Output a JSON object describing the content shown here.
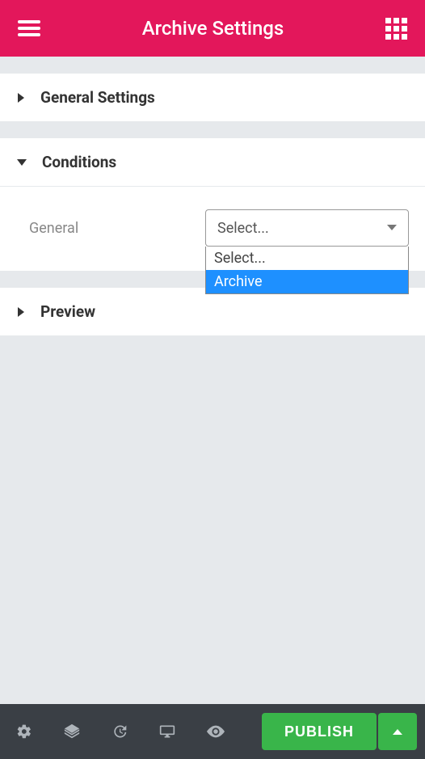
{
  "header": {
    "title": "Archive Settings"
  },
  "sections": {
    "general_settings": {
      "title": "General Settings",
      "expanded": false
    },
    "conditions": {
      "title": "Conditions",
      "expanded": true,
      "field_label": "General",
      "select_value": "Select...",
      "options": {
        "opt0": "Select...",
        "opt1": "Archive"
      }
    },
    "preview": {
      "title": "Preview",
      "expanded": false
    }
  },
  "footer": {
    "publish_label": "PUBLISH"
  }
}
